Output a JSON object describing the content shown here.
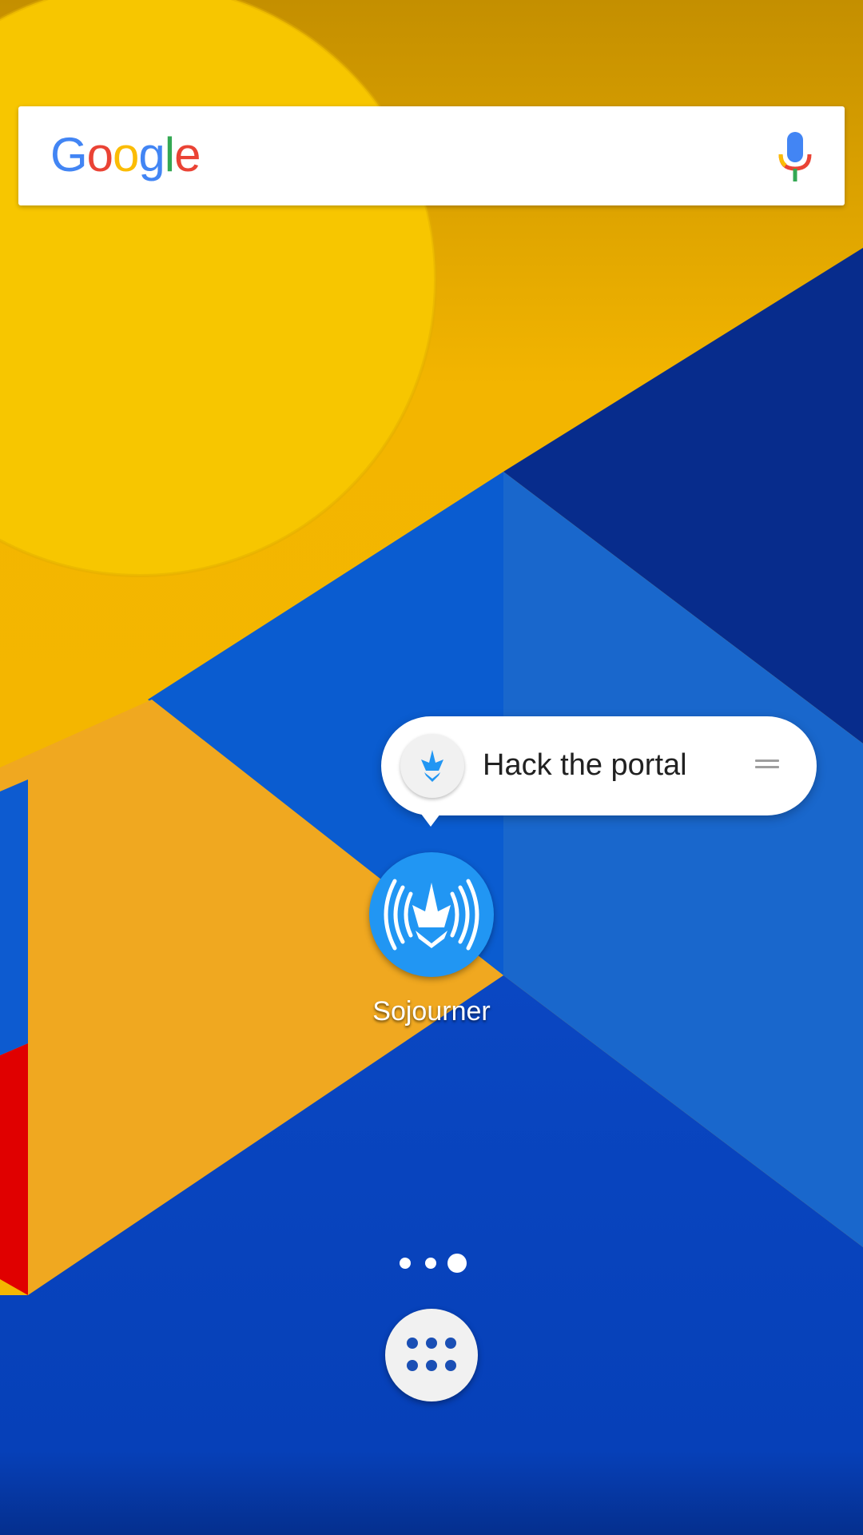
{
  "search": {
    "logo_letters": [
      "G",
      "o",
      "o",
      "g",
      "l",
      "e"
    ],
    "mic_icon": "mic-icon"
  },
  "shortcut_popup": {
    "label": "Hack the portal",
    "icon": "ingress-scanner-icon",
    "handle_icon": "drag-handle-icon"
  },
  "home": {
    "app_label": "Sojourner",
    "app_icon": "sojourner-app-icon",
    "page_count": 3,
    "active_page": 3,
    "app_drawer_icon": "apps-grid-icon"
  },
  "colors": {
    "wallpaper_yellow": "#F4B400",
    "wallpaper_blue": "#0D47C0",
    "app_icon_bg": "#2196F3",
    "drawer_dots": "#1A4FB5"
  }
}
